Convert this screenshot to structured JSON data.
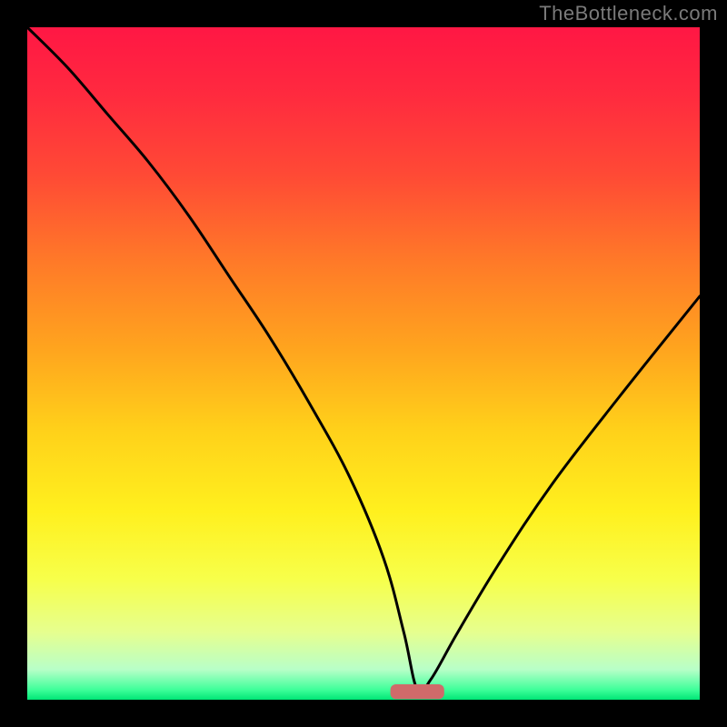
{
  "watermark": "TheBottleneck.com",
  "colors": {
    "frame": "#000000",
    "watermark": "#7a7a7a",
    "curve": "#000000",
    "marker_fill": "#cf6a6a",
    "gradient_stops": [
      {
        "offset": 0.0,
        "color": "#ff1744"
      },
      {
        "offset": 0.1,
        "color": "#ff2a3f"
      },
      {
        "offset": 0.22,
        "color": "#ff4a35"
      },
      {
        "offset": 0.35,
        "color": "#ff7a28"
      },
      {
        "offset": 0.48,
        "color": "#ffa51e"
      },
      {
        "offset": 0.6,
        "color": "#ffd11a"
      },
      {
        "offset": 0.72,
        "color": "#fff01e"
      },
      {
        "offset": 0.82,
        "color": "#f7ff4a"
      },
      {
        "offset": 0.9,
        "color": "#e6ff8f"
      },
      {
        "offset": 0.955,
        "color": "#b8ffc8"
      },
      {
        "offset": 0.985,
        "color": "#3fff9a"
      },
      {
        "offset": 1.0,
        "color": "#00e676"
      }
    ]
  },
  "chart_data": {
    "type": "line",
    "title": "",
    "xlabel": "",
    "ylabel": "",
    "xlim": [
      0,
      100
    ],
    "ylim": [
      0,
      100
    ],
    "optimum_x": 58,
    "series": [
      {
        "name": "bottleneck-curve",
        "x": [
          0,
          6,
          12,
          18,
          24,
          30,
          36,
          42,
          48,
          53,
          56,
          58,
          60,
          64,
          70,
          78,
          88,
          100
        ],
        "values": [
          100,
          94,
          87,
          80,
          72,
          63,
          54,
          44,
          33,
          21,
          10,
          1.5,
          3,
          10,
          20,
          32,
          45,
          60
        ]
      }
    ],
    "marker": {
      "x_center": 58,
      "y": 1.2,
      "half_width": 4,
      "height": 2.2
    }
  }
}
